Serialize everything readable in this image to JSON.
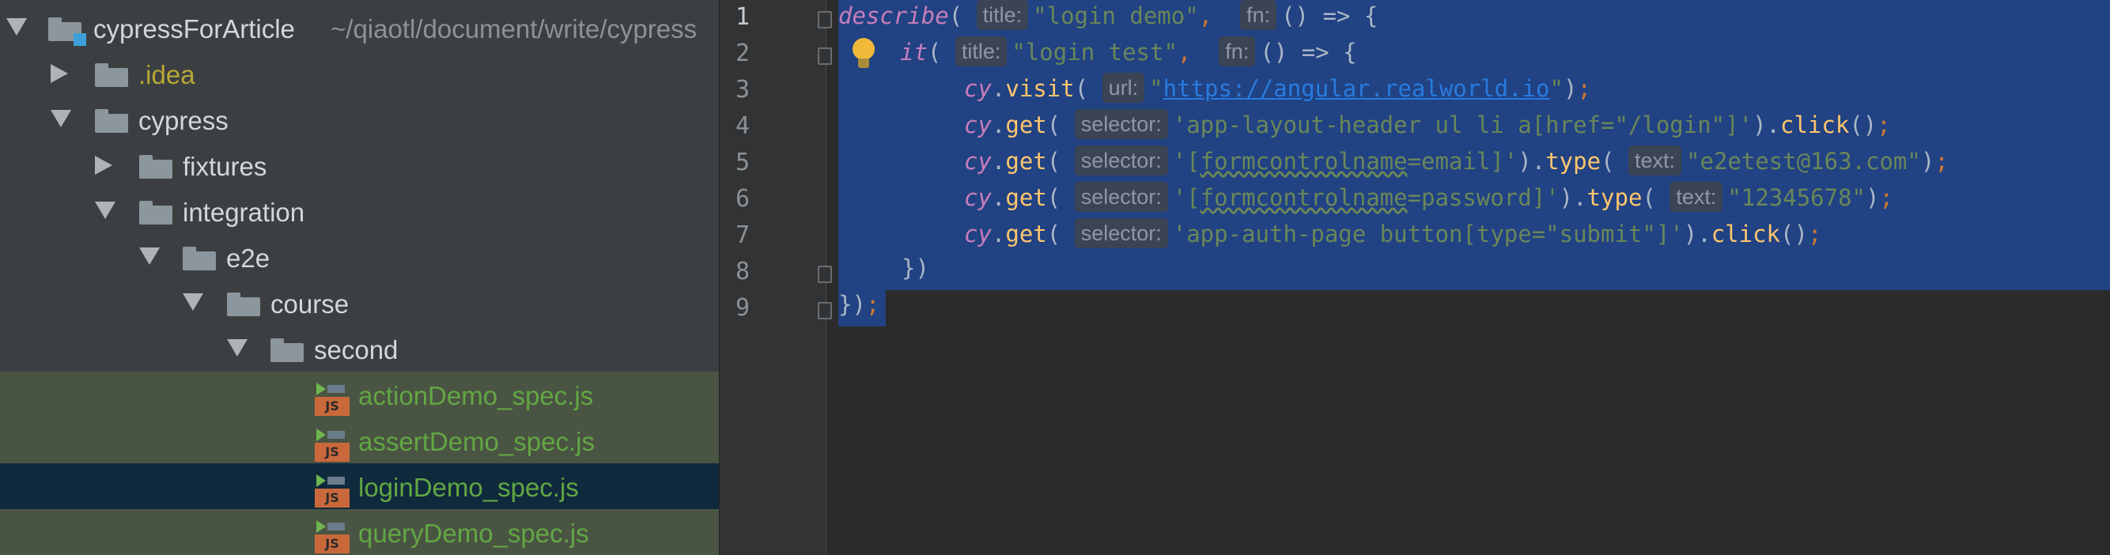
{
  "project_tree": {
    "root": {
      "name": "cypressForArticle",
      "path": "~/qiaotl/document/write/cypress"
    },
    "items": [
      {
        "label": ".idea"
      },
      {
        "label": "cypress"
      },
      {
        "label": "fixtures"
      },
      {
        "label": "integration"
      },
      {
        "label": "e2e"
      },
      {
        "label": "course"
      },
      {
        "label": "second"
      },
      {
        "label": "actionDemo_spec.js"
      },
      {
        "label": "assertDemo_spec.js"
      },
      {
        "label": "loginDemo_spec.js"
      },
      {
        "label": "queryDemo_spec.js"
      }
    ],
    "js_badge": "JS"
  },
  "editor": {
    "line_numbers": [
      "1",
      "2",
      "3",
      "4",
      "5",
      "6",
      "7",
      "8",
      "9"
    ],
    "hints": {
      "title": "title:",
      "fn": "fn:",
      "url": "url:",
      "selector": "selector:",
      "text": "text:"
    },
    "lines": {
      "l1": {
        "keyword": "describe",
        "paren": "(",
        "string": "\"login demo\"",
        "comma": ",",
        "arrow": "() => {"
      },
      "l2": {
        "keyword": "it",
        "paren": "(",
        "string": "\"login test\"",
        "comma": ",",
        "arrow": "() => {"
      },
      "l3": {
        "obj": "cy",
        "method": "visit",
        "open": "(",
        "q1": "\"",
        "url": "https://angular.realworld.io",
        "q2": "\"",
        "close": ")",
        "semi": ";"
      },
      "l4": {
        "obj": "cy",
        "method": "get",
        "open": "(",
        "string": "'app-layout-header ul li a[href=\"/login\"]'",
        "close": ")",
        "method2": "click",
        "call": "()",
        "semi": ";"
      },
      "l5": {
        "obj": "cy",
        "method": "get",
        "open": "(",
        "s_a": "'[",
        "s_b": "formcontrolname",
        "s_c": "=email]'",
        "close": ")",
        "method2": "type",
        "open2": "(",
        "string2": "\"e2etest@163.com\"",
        "close2": ")",
        "semi": ";"
      },
      "l6": {
        "obj": "cy",
        "method": "get",
        "open": "(",
        "s_a": "'[",
        "s_b": "formcontrolname",
        "s_c": "=password]'",
        "close": ")",
        "method2": "type",
        "open2": "(",
        "string2": "\"12345678\"",
        "close2": ")",
        "semi": ";"
      },
      "l7": {
        "obj": "cy",
        "method": "get",
        "open": "(",
        "string": "'app-auth-page button[type=\"submit\"]'",
        "close": ")",
        "method2": "click",
        "call": "()",
        "semi": ";"
      },
      "l8": {
        "text": "})"
      },
      "l9": {
        "text": "})",
        "semi": ";"
      }
    }
  },
  "colors": {
    "tree_bg": "#3c3f41",
    "editor_bg": "#2b2b2b",
    "selection": "#214283",
    "vcs_added": "#62a743"
  }
}
